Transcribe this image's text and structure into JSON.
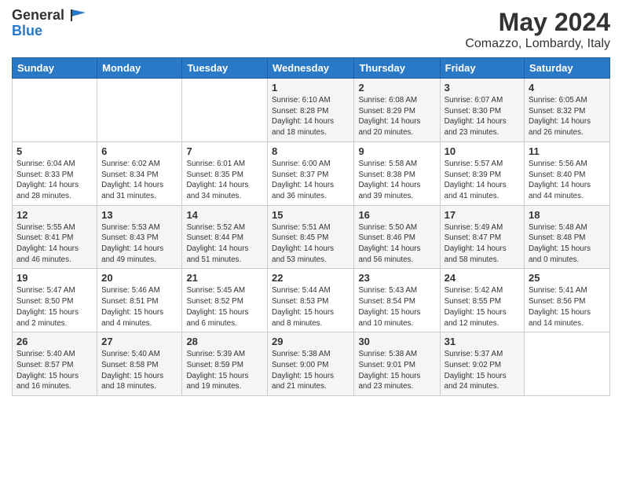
{
  "logo": {
    "line1": "General",
    "line2": "Blue"
  },
  "title": "May 2024",
  "subtitle": "Comazzo, Lombardy, Italy",
  "days_of_week": [
    "Sunday",
    "Monday",
    "Tuesday",
    "Wednesday",
    "Thursday",
    "Friday",
    "Saturday"
  ],
  "weeks": [
    [
      {
        "day": "",
        "info": ""
      },
      {
        "day": "",
        "info": ""
      },
      {
        "day": "",
        "info": ""
      },
      {
        "day": "1",
        "info": "Sunrise: 6:10 AM\nSunset: 8:28 PM\nDaylight: 14 hours\nand 18 minutes."
      },
      {
        "day": "2",
        "info": "Sunrise: 6:08 AM\nSunset: 8:29 PM\nDaylight: 14 hours\nand 20 minutes."
      },
      {
        "day": "3",
        "info": "Sunrise: 6:07 AM\nSunset: 8:30 PM\nDaylight: 14 hours\nand 23 minutes."
      },
      {
        "day": "4",
        "info": "Sunrise: 6:05 AM\nSunset: 8:32 PM\nDaylight: 14 hours\nand 26 minutes."
      }
    ],
    [
      {
        "day": "5",
        "info": "Sunrise: 6:04 AM\nSunset: 8:33 PM\nDaylight: 14 hours\nand 28 minutes."
      },
      {
        "day": "6",
        "info": "Sunrise: 6:02 AM\nSunset: 8:34 PM\nDaylight: 14 hours\nand 31 minutes."
      },
      {
        "day": "7",
        "info": "Sunrise: 6:01 AM\nSunset: 8:35 PM\nDaylight: 14 hours\nand 34 minutes."
      },
      {
        "day": "8",
        "info": "Sunrise: 6:00 AM\nSunset: 8:37 PM\nDaylight: 14 hours\nand 36 minutes."
      },
      {
        "day": "9",
        "info": "Sunrise: 5:58 AM\nSunset: 8:38 PM\nDaylight: 14 hours\nand 39 minutes."
      },
      {
        "day": "10",
        "info": "Sunrise: 5:57 AM\nSunset: 8:39 PM\nDaylight: 14 hours\nand 41 minutes."
      },
      {
        "day": "11",
        "info": "Sunrise: 5:56 AM\nSunset: 8:40 PM\nDaylight: 14 hours\nand 44 minutes."
      }
    ],
    [
      {
        "day": "12",
        "info": "Sunrise: 5:55 AM\nSunset: 8:41 PM\nDaylight: 14 hours\nand 46 minutes."
      },
      {
        "day": "13",
        "info": "Sunrise: 5:53 AM\nSunset: 8:43 PM\nDaylight: 14 hours\nand 49 minutes."
      },
      {
        "day": "14",
        "info": "Sunrise: 5:52 AM\nSunset: 8:44 PM\nDaylight: 14 hours\nand 51 minutes."
      },
      {
        "day": "15",
        "info": "Sunrise: 5:51 AM\nSunset: 8:45 PM\nDaylight: 14 hours\nand 53 minutes."
      },
      {
        "day": "16",
        "info": "Sunrise: 5:50 AM\nSunset: 8:46 PM\nDaylight: 14 hours\nand 56 minutes."
      },
      {
        "day": "17",
        "info": "Sunrise: 5:49 AM\nSunset: 8:47 PM\nDaylight: 14 hours\nand 58 minutes."
      },
      {
        "day": "18",
        "info": "Sunrise: 5:48 AM\nSunset: 8:48 PM\nDaylight: 15 hours\nand 0 minutes."
      }
    ],
    [
      {
        "day": "19",
        "info": "Sunrise: 5:47 AM\nSunset: 8:50 PM\nDaylight: 15 hours\nand 2 minutes."
      },
      {
        "day": "20",
        "info": "Sunrise: 5:46 AM\nSunset: 8:51 PM\nDaylight: 15 hours\nand 4 minutes."
      },
      {
        "day": "21",
        "info": "Sunrise: 5:45 AM\nSunset: 8:52 PM\nDaylight: 15 hours\nand 6 minutes."
      },
      {
        "day": "22",
        "info": "Sunrise: 5:44 AM\nSunset: 8:53 PM\nDaylight: 15 hours\nand 8 minutes."
      },
      {
        "day": "23",
        "info": "Sunrise: 5:43 AM\nSunset: 8:54 PM\nDaylight: 15 hours\nand 10 minutes."
      },
      {
        "day": "24",
        "info": "Sunrise: 5:42 AM\nSunset: 8:55 PM\nDaylight: 15 hours\nand 12 minutes."
      },
      {
        "day": "25",
        "info": "Sunrise: 5:41 AM\nSunset: 8:56 PM\nDaylight: 15 hours\nand 14 minutes."
      }
    ],
    [
      {
        "day": "26",
        "info": "Sunrise: 5:40 AM\nSunset: 8:57 PM\nDaylight: 15 hours\nand 16 minutes."
      },
      {
        "day": "27",
        "info": "Sunrise: 5:40 AM\nSunset: 8:58 PM\nDaylight: 15 hours\nand 18 minutes."
      },
      {
        "day": "28",
        "info": "Sunrise: 5:39 AM\nSunset: 8:59 PM\nDaylight: 15 hours\nand 19 minutes."
      },
      {
        "day": "29",
        "info": "Sunrise: 5:38 AM\nSunset: 9:00 PM\nDaylight: 15 hours\nand 21 minutes."
      },
      {
        "day": "30",
        "info": "Sunrise: 5:38 AM\nSunset: 9:01 PM\nDaylight: 15 hours\nand 23 minutes."
      },
      {
        "day": "31",
        "info": "Sunrise: 5:37 AM\nSunset: 9:02 PM\nDaylight: 15 hours\nand 24 minutes."
      },
      {
        "day": "",
        "info": ""
      }
    ]
  ]
}
